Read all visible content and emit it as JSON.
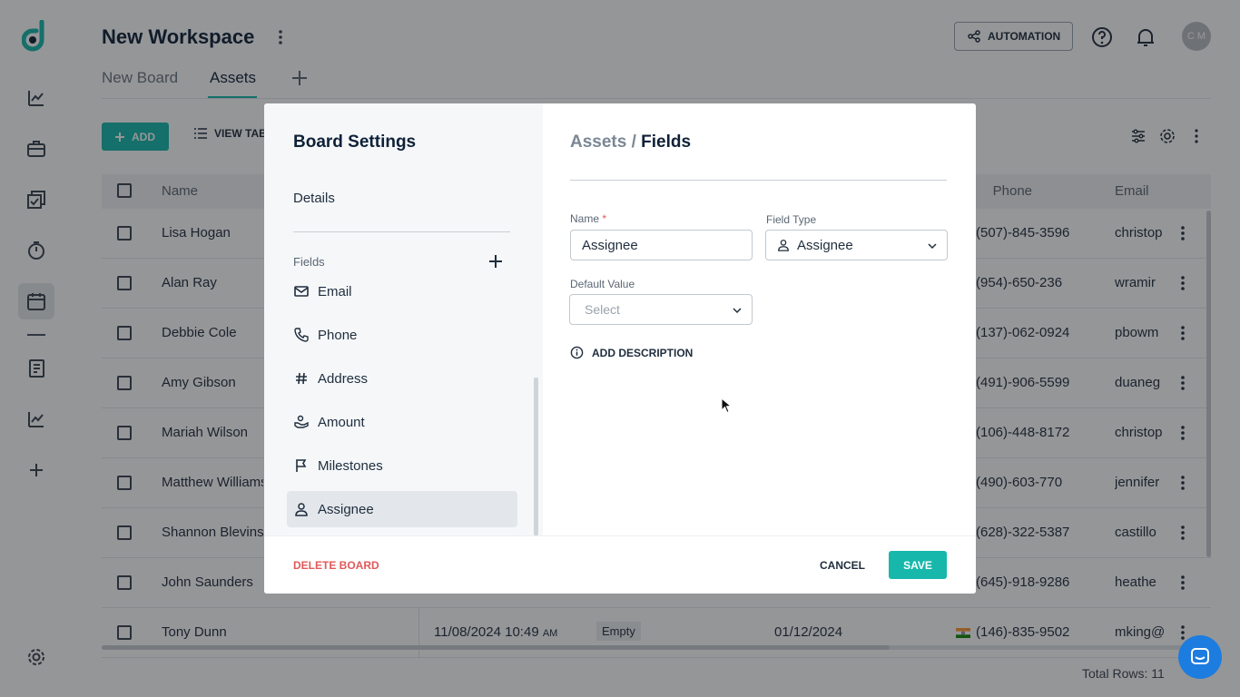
{
  "colors": {
    "accent": "#17b8ab",
    "danger": "#e05a5a",
    "dark": "#0f2137"
  },
  "app": {
    "workspace_title": "New Workspace",
    "tabs": [
      {
        "label": "New Board"
      },
      {
        "label": "Assets"
      }
    ],
    "automation_label": "AUTOMATION",
    "avatar_initials": "C M",
    "add_label": "ADD",
    "view_label": "VIEW TAB",
    "grid": {
      "headers": {
        "name": "Name",
        "phone": "Phone",
        "email": "Email"
      },
      "rows": [
        {
          "name": "Lisa Hogan",
          "phone": "(507)-845-3596",
          "email": "christop"
        },
        {
          "name": "Alan Ray",
          "phone": "(954)-650-236",
          "email": "wramir"
        },
        {
          "name": "Debbie Cole",
          "phone": "(137)-062-0924",
          "email": "pbowm"
        },
        {
          "name": "Amy Gibson",
          "phone": "(491)-906-5599",
          "email": "duaneg"
        },
        {
          "name": "Mariah Wilson",
          "phone": "(106)-448-8172",
          "email": "christop"
        },
        {
          "name": "Matthew Williams",
          "phone": "(490)-603-770",
          "email": "jennifer"
        },
        {
          "name": "Shannon Blevins",
          "phone": "(628)-322-5387",
          "email": "castillo"
        },
        {
          "name": "John Saunders",
          "phone": "(645)-918-9286",
          "email": "heathe"
        },
        {
          "name": "Tony Dunn",
          "created": "11/08/2024 10:49",
          "created_suffix": "AM",
          "status": "Empty",
          "date": "01/12/2024",
          "phone": "(146)-835-9502",
          "email": "mking@"
        }
      ]
    },
    "total_rows": "Total Rows: 11"
  },
  "modal": {
    "title": "Board Settings",
    "details_label": "Details",
    "fields_label": "Fields",
    "fields": [
      {
        "label": "Email",
        "icon": "mail-icon"
      },
      {
        "label": "Phone",
        "icon": "phone-icon"
      },
      {
        "label": "Address",
        "icon": "hash-icon"
      },
      {
        "label": "Amount",
        "icon": "money-hand-icon"
      },
      {
        "label": "Milestones",
        "icon": "flag-icon"
      },
      {
        "label": "Assignee",
        "icon": "user-icon",
        "selected": true
      }
    ],
    "breadcrumb": {
      "parent": "Assets",
      "separator": " / ",
      "current": "Fields"
    },
    "form": {
      "name_label": "Name",
      "name_required": "*",
      "name_value": "Assignee",
      "field_type_label": "Field Type",
      "field_type_value": "Assignee",
      "default_value_label": "Default Value",
      "default_value_placeholder": "Select"
    },
    "add_description_label": "ADD DESCRIPTION",
    "delete_label": "DELETE BOARD",
    "cancel_label": "CANCEL",
    "save_label": "SAVE"
  }
}
